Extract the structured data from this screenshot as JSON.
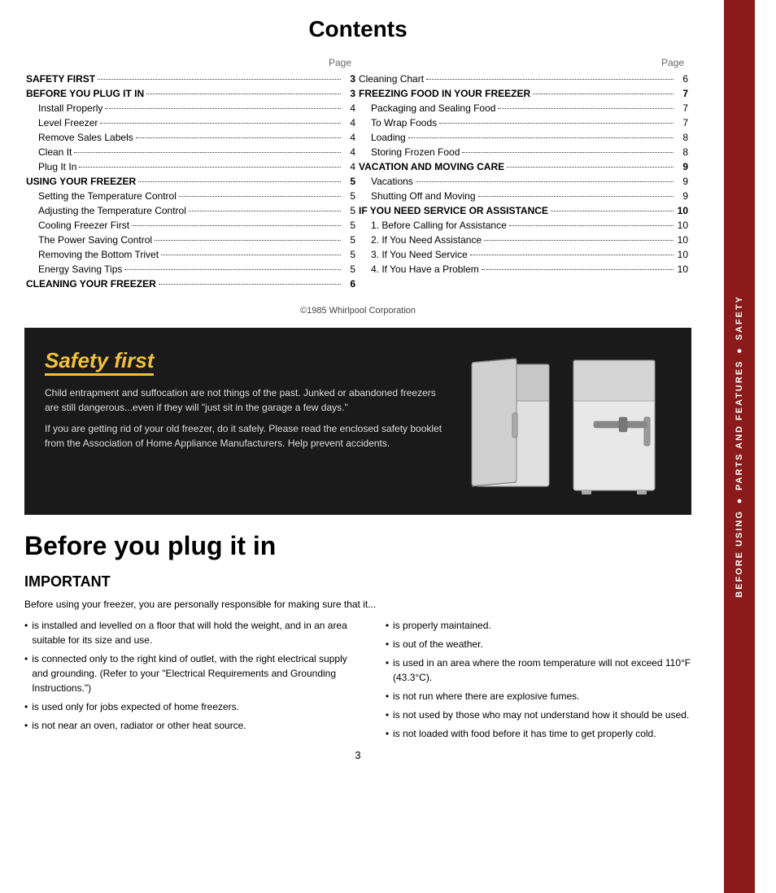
{
  "sidebar": {
    "text": "BEFORE USING ● PARTS AND FEATURES ● SAFETY"
  },
  "contents": {
    "title": "Contents",
    "page_header": "Page",
    "left_col": [
      {
        "label": "SAFETY FIRST",
        "page": "3",
        "bold": true,
        "indent": false
      },
      {
        "label": "BEFORE YOU PLUG IT IN",
        "page": "3",
        "bold": true,
        "indent": false
      },
      {
        "label": "Install Properly",
        "page": "4",
        "bold": false,
        "indent": true
      },
      {
        "label": "Level Freezer",
        "page": "4",
        "bold": false,
        "indent": true
      },
      {
        "label": "Remove Sales Labels",
        "page": "4",
        "bold": false,
        "indent": true
      },
      {
        "label": "Clean It",
        "page": "4",
        "bold": false,
        "indent": true
      },
      {
        "label": "Plug It In",
        "page": "4",
        "bold": false,
        "indent": true
      },
      {
        "label": "USING YOUR FREEZER",
        "page": "5",
        "bold": true,
        "indent": false
      },
      {
        "label": "Setting the Temperature Control",
        "page": "5",
        "bold": false,
        "indent": true
      },
      {
        "label": "Adjusting the Temperature Control",
        "page": "5",
        "bold": false,
        "indent": true
      },
      {
        "label": "Cooling Freezer First",
        "page": "5",
        "bold": false,
        "indent": true
      },
      {
        "label": "The Power Saving Control",
        "page": "5",
        "bold": false,
        "indent": true
      },
      {
        "label": "Removing the Bottom Trivet",
        "page": "5",
        "bold": false,
        "indent": true
      },
      {
        "label": "Energy Saving Tips",
        "page": "5",
        "bold": false,
        "indent": true
      },
      {
        "label": "CLEANING YOUR FREEZER",
        "page": "6",
        "bold": true,
        "indent": false
      }
    ],
    "right_col": [
      {
        "label": "Cleaning Chart",
        "page": "6",
        "bold": false,
        "indent": false
      },
      {
        "label": "FREEZING FOOD IN YOUR FREEZER",
        "page": "7",
        "bold": true,
        "indent": false
      },
      {
        "label": "Packaging and Sealing Food",
        "page": "7",
        "bold": false,
        "indent": true
      },
      {
        "label": "To Wrap Foods",
        "page": "7",
        "bold": false,
        "indent": true
      },
      {
        "label": "Loading",
        "page": "8",
        "bold": false,
        "indent": true
      },
      {
        "label": "Storing Frozen Food",
        "page": "8",
        "bold": false,
        "indent": true
      },
      {
        "label": "VACATION AND MOVING CARE",
        "page": "9",
        "bold": true,
        "indent": false
      },
      {
        "label": "Vacations",
        "page": "9",
        "bold": false,
        "indent": true
      },
      {
        "label": "Shutting Off and Moving",
        "page": "9",
        "bold": false,
        "indent": true
      },
      {
        "label": "IF YOU NEED SERVICE OR ASSISTANCE",
        "page": "10",
        "bold": true,
        "indent": false
      },
      {
        "label": "1. Before Calling for Assistance",
        "page": "10",
        "bold": false,
        "indent": true
      },
      {
        "label": "2. If You Need Assistance",
        "page": "10",
        "bold": false,
        "indent": true
      },
      {
        "label": "3. If You Need Service",
        "page": "10",
        "bold": false,
        "indent": true
      },
      {
        "label": "4. If You Have a Problem",
        "page": "10",
        "bold": false,
        "indent": true
      }
    ]
  },
  "copyright": "©1985 Whirlpool Corporation",
  "safety": {
    "title": "Safety first",
    "body1": "Child entrapment and suffocation are not things of the past. Junked or abandoned freezers are still dangerous...even if they will \"just sit in the garage a few days.\"",
    "body2": "If you are getting rid of your old freezer, do it safely. Please read the enclosed safety booklet from the Association of Home Appliance Manufacturers. Help prevent accidents."
  },
  "before_plug": {
    "title": "Before you plug it in",
    "important_title": "IMPORTANT",
    "intro": "Before using your freezer, you are personally responsible for making sure that it...",
    "left_bullets": [
      "is installed and levelled on a floor that will hold the weight, and in an area suitable for its size and use.",
      "is connected only to the right kind of outlet, with the right electrical supply and grounding. (Refer to your \"Electrical Requirements and Grounding Instructions.\")",
      "is used only for jobs expected of home freezers.",
      "is not near an oven, radiator or other heat source."
    ],
    "right_bullets": [
      "is properly maintained.",
      "is out of the weather.",
      "is used in an area where the room temperature will not exceed 110°F (43.3°C).",
      "is not run where there are explosive fumes.",
      "is not used by those who may not understand how it should be used.",
      "is not loaded with food before it has time to get properly cold."
    ]
  },
  "page_number": "3"
}
